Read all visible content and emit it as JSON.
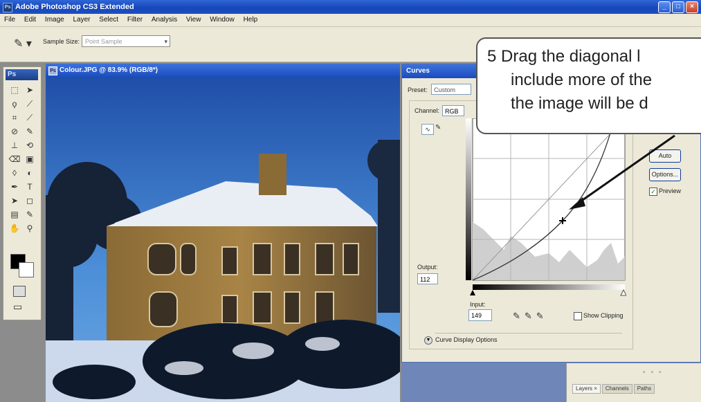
{
  "app": {
    "title": "Adobe Photoshop CS3 Extended"
  },
  "menu": [
    "File",
    "Edit",
    "Image",
    "Layer",
    "Select",
    "Filter",
    "Analysis",
    "View",
    "Window",
    "Help"
  ],
  "options_bar": {
    "sample_size_label": "Sample Size:",
    "sample_size_value": "Point Sample"
  },
  "toolbox": {
    "logo": "Ps"
  },
  "document": {
    "title": "Colour.JPG @ 83.9% (RGB/8*)"
  },
  "curves": {
    "title": "Curves",
    "preset_label": "Preset:",
    "preset_value": "Custom",
    "channel_label": "Channel:",
    "channel_value": "RGB",
    "output_label": "Output:",
    "output_value": "112",
    "input_label": "Input:",
    "input_value": "149",
    "show_clipping_label": "Show Clipping",
    "curve_display_options_label": "Curve Display Options",
    "auto_label": "Auto",
    "options_label": "Options...",
    "preview_label": "Preview",
    "preview_checked": true
  },
  "panels": {
    "tabs": [
      "Layers ×",
      "Channels",
      "Paths"
    ]
  },
  "callout": {
    "lines": [
      "5  Drag the diagonal l",
      "include more of the",
      "the image will be d"
    ]
  },
  "colors": {
    "accent": "#1a4bbd",
    "chrome": "#ece9d8"
  }
}
